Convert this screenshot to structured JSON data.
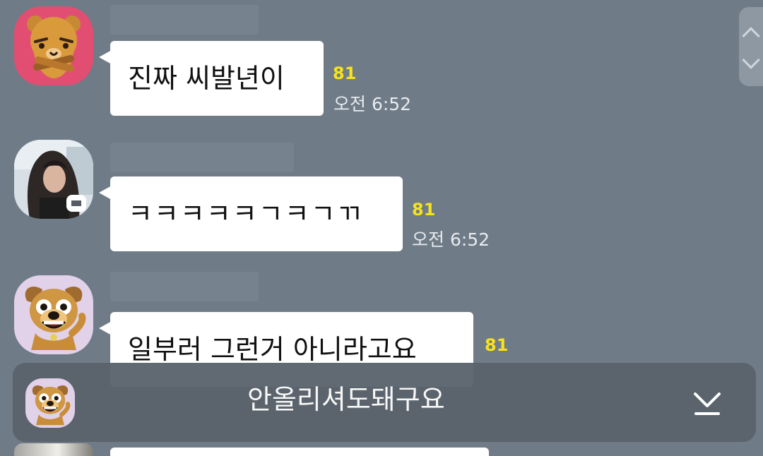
{
  "messages": [
    {
      "text": "진짜 씨발년이",
      "unread_count": "81",
      "time": "오전 6:52",
      "avatar_icon": "ryan-bear-icon"
    },
    {
      "text": "ㅋㅋㅋㅋㅋㄱㅋㄱㄲ",
      "unread_count": "81",
      "time": "오전 6:52",
      "avatar_icon": "profile-photo"
    },
    {
      "text": "일부러 그런거 아니라고요",
      "unread_count": "81",
      "avatar_icon": "frodo-dog-icon"
    }
  ],
  "preview": {
    "text": "안올리셔도돼구요",
    "avatar_icon": "frodo-dog-icon",
    "action_icon": "scroll-to-bottom-icon"
  },
  "scroll": {
    "up_icon": "chevron-up-icon",
    "down_icon": "chevron-down-icon"
  },
  "colors": {
    "chat_background": "#6f7b87",
    "bubble_background": "#ffffff",
    "unread_count": "#f6e21c",
    "timestamp": "#e7ebef",
    "preview_background": "#5b636c"
  }
}
